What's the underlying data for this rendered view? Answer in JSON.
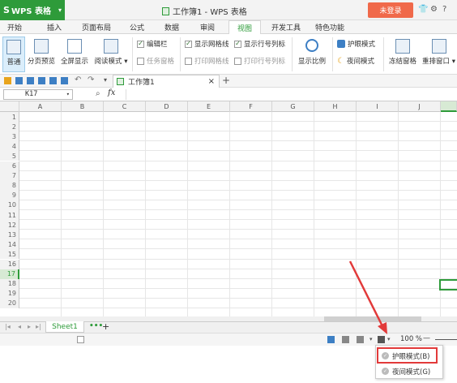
{
  "app": {
    "name": "WPS 表格",
    "logo": "S",
    "doc_title": "工作簿1 - WPS 表格",
    "login": "未登录"
  },
  "menu": {
    "tabs": [
      "开始",
      "插入",
      "页面布局",
      "公式",
      "数据",
      "审阅",
      "视图",
      "开发工具",
      "特色功能"
    ],
    "active": "视图"
  },
  "ribbon": {
    "normal": "普通",
    "page_break": "分页预览",
    "fullscreen": "全屏显示",
    "reading_mode": "阅读模式",
    "edit_bar": "编辑栏",
    "task_pane": "任务窗格",
    "show_gridlines": "显示网格线",
    "print_gridlines": "打印网格线",
    "show_headers": "显示行号列标",
    "print_headers": "打印行号列标",
    "zoom": "显示比例",
    "eye_mode": "护眼模式",
    "night_mode": "夜间模式",
    "freeze": "冻结窗格",
    "arrange": "重排窗口"
  },
  "quick": {
    "doc_tab": "工作簿1",
    "close": "×",
    "add": "+"
  },
  "formula": {
    "cell_ref": "K17",
    "fx": "fx"
  },
  "columns": [
    "A",
    "B",
    "C",
    "D",
    "E",
    "F",
    "G",
    "H",
    "I",
    "J"
  ],
  "rows": [
    "1",
    "2",
    "3",
    "4",
    "5",
    "6",
    "7",
    "8",
    "9",
    "10",
    "11",
    "12",
    "13",
    "14",
    "15",
    "16",
    "17",
    "18",
    "19",
    "20"
  ],
  "sheet": {
    "name": "Sheet1",
    "more": "•••",
    "add": "+"
  },
  "status": {
    "zoom": "100 %",
    "minus": "—"
  },
  "popup": {
    "eye_mode": "护眼模式(B)",
    "night_mode": "夜间模式(G)"
  },
  "colors": {
    "brand_green": "#2e9b3a",
    "login_orange": "#f0694a",
    "highlight_red": "#e23a3a"
  }
}
